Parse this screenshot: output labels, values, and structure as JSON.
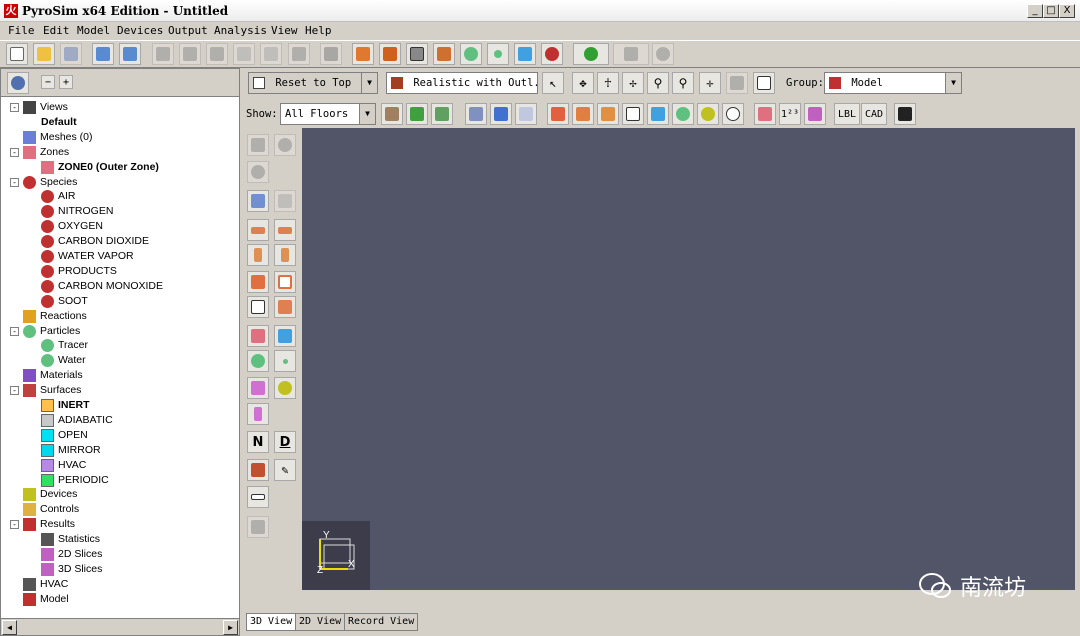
{
  "window": {
    "title": "PyroSim x64 Edition - Untitled",
    "buttons": [
      "_",
      "□",
      "X"
    ]
  },
  "menu": [
    "File",
    "Edit",
    "Model",
    "Devices",
    "Output",
    "Analysis",
    "View",
    "Help"
  ],
  "toolbar_top": {
    "buttons": [
      "new-icon",
      "open-icon",
      "save-icon",
      "import-icon",
      "export-icon",
      "undo-icon",
      "redo-icon",
      "cut-icon",
      "copy-icon",
      "paste-icon",
      "delete-icon",
      "properties-icon",
      "obstruction-icon",
      "hole-icon",
      "vent-icon",
      "edit-icon",
      "particles-icon",
      "particle-icon",
      "thermocouple-icon",
      "species-icon",
      "run-icon",
      "pause-icon",
      "stop-icon"
    ]
  },
  "view_toolbar": {
    "reset_label": "Reset to Top",
    "render_mode": "Realistic with Outl...",
    "group_label": "Group:",
    "group_value": "Model",
    "show_label": "Show:",
    "floors_value": "All Floors",
    "lbl_button": "LBL",
    "cad_button": "CAD",
    "superscript_label": "1²³"
  },
  "tree": {
    "items": [
      {
        "label": "Views",
        "level": 0,
        "expander": "-",
        "icon": "views-icon",
        "bold": false
      },
      {
        "label": "Default",
        "level": 1,
        "expander": "",
        "icon": "",
        "bold": true
      },
      {
        "label": "Meshes (0)",
        "level": 0,
        "expander": "",
        "icon": "mesh-icon",
        "bold": false
      },
      {
        "label": "Zones",
        "level": 0,
        "expander": "-",
        "icon": "zone-icon",
        "bold": false
      },
      {
        "label": "ZONE0 (Outer Zone)",
        "level": 1,
        "expander": "",
        "icon": "zone-icon",
        "bold": true
      },
      {
        "label": "Species",
        "level": 0,
        "expander": "-",
        "icon": "species-icon",
        "bold": false
      },
      {
        "label": "AIR",
        "level": 1,
        "expander": "",
        "icon": "species-icon",
        "bold": false
      },
      {
        "label": "NITROGEN",
        "level": 1,
        "expander": "",
        "icon": "species-icon",
        "bold": false
      },
      {
        "label": "OXYGEN",
        "level": 1,
        "expander": "",
        "icon": "species-icon",
        "bold": false
      },
      {
        "label": "CARBON DIOXIDE",
        "level": 1,
        "expander": "",
        "icon": "species-icon",
        "bold": false
      },
      {
        "label": "WATER VAPOR",
        "level": 1,
        "expander": "",
        "icon": "species-icon",
        "bold": false
      },
      {
        "label": "PRODUCTS",
        "level": 1,
        "expander": "",
        "icon": "species-icon",
        "bold": false
      },
      {
        "label": "CARBON MONOXIDE",
        "level": 1,
        "expander": "",
        "icon": "species-icon",
        "bold": false
      },
      {
        "label": "SOOT",
        "level": 1,
        "expander": "",
        "icon": "species-icon",
        "bold": false
      },
      {
        "label": "Reactions",
        "level": 0,
        "expander": "",
        "icon": "reaction-icon",
        "bold": false
      },
      {
        "label": "Particles",
        "level": 0,
        "expander": "-",
        "icon": "particles-icon",
        "bold": false
      },
      {
        "label": "Tracer",
        "level": 1,
        "expander": "",
        "icon": "particles-icon",
        "bold": false
      },
      {
        "label": "Water",
        "level": 1,
        "expander": "",
        "icon": "particles-icon",
        "bold": false
      },
      {
        "label": "Materials",
        "level": 0,
        "expander": "",
        "icon": "materials-icon",
        "bold": false
      },
      {
        "label": "Surfaces",
        "level": 0,
        "expander": "-",
        "icon": "surfaces-icon",
        "bold": false
      },
      {
        "label": "INERT",
        "level": 1,
        "expander": "",
        "icon": "surface-inert",
        "bold": true
      },
      {
        "label": "ADIABATIC",
        "level": 1,
        "expander": "",
        "icon": "surface-adiabatic",
        "bold": false
      },
      {
        "label": "OPEN",
        "level": 1,
        "expander": "",
        "icon": "surface-open",
        "bold": false
      },
      {
        "label": "MIRROR",
        "level": 1,
        "expander": "",
        "icon": "surface-mirror",
        "bold": false
      },
      {
        "label": "HVAC",
        "level": 1,
        "expander": "",
        "icon": "surface-hvac",
        "bold": false
      },
      {
        "label": "PERIODIC",
        "level": 1,
        "expander": "",
        "icon": "surface-periodic",
        "bold": false
      },
      {
        "label": "Devices",
        "level": 0,
        "expander": "",
        "icon": "devices-icon",
        "bold": false
      },
      {
        "label": "Controls",
        "level": 0,
        "expander": "",
        "icon": "controls-icon",
        "bold": false
      },
      {
        "label": "Results",
        "level": 0,
        "expander": "-",
        "icon": "results-icon",
        "bold": false
      },
      {
        "label": "Statistics",
        "level": 1,
        "expander": "",
        "icon": "statistics-icon",
        "bold": false
      },
      {
        "label": "2D Slices",
        "level": 1,
        "expander": "",
        "icon": "slice-icon",
        "bold": false
      },
      {
        "label": "3D Slices",
        "level": 1,
        "expander": "",
        "icon": "slice-icon",
        "bold": false
      },
      {
        "label": "HVAC",
        "level": 0,
        "expander": "",
        "icon": "hvac-icon",
        "bold": false
      },
      {
        "label": "Model",
        "level": 0,
        "expander": "",
        "icon": "model-icon",
        "bold": false
      }
    ]
  },
  "colors": {
    "surface-inert": "#ffc04c",
    "surface-adiabatic": "#c8c8c8",
    "surface-open": "#00e0f0",
    "surface-mirror": "#00d8f0",
    "surface-hvac": "#b888e8",
    "surface-periodic": "#30e060",
    "viewport": "#525568"
  },
  "side_buttons": {
    "n_label": "N",
    "d_label": "D"
  },
  "axes": {
    "x": "X",
    "y": "Y",
    "z": "Z"
  },
  "tabs": [
    "3D View",
    "2D View",
    "Record View"
  ],
  "watermark": "南流坊"
}
